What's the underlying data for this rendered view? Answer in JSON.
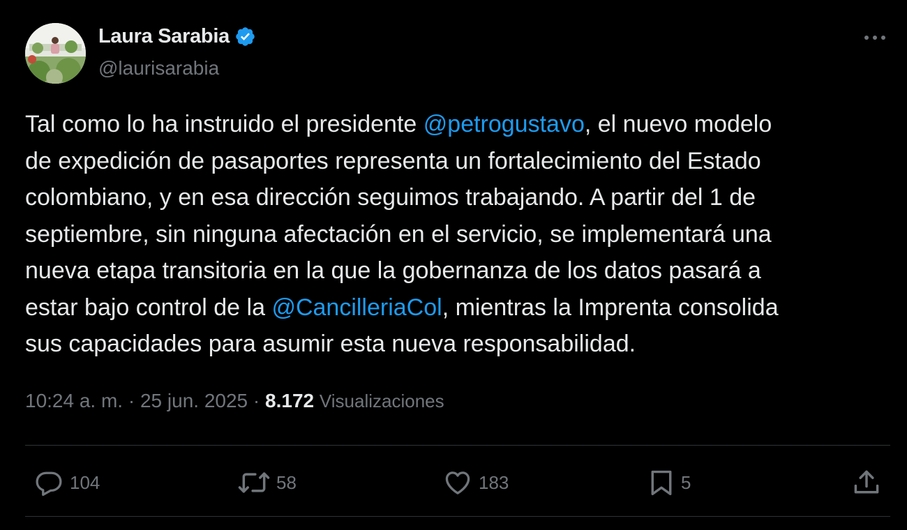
{
  "author": {
    "display_name": "Laura Sarabia",
    "handle": "@laurisarabia",
    "verified_color": "#1d9bf0"
  },
  "tweet": {
    "segments": [
      "Tal como lo ha instruido el presidente ",
      "@petrogustavo",
      ", el nuevo modelo",
      "de expedición de pasaportes representa un fortalecimiento del Estado",
      "colombiano, y en esa dirección seguimos trabajando. A partir del 1 de",
      "septiembre, sin ninguna afectación en el servicio, se implementará una",
      "nueva etapa transitoria en la que la gobernanza de los datos pasará a",
      "estar bajo control de la ",
      "@CancilleriaCol",
      ", mientras la Imprenta consolida",
      "sus capacidades para asumir esta nueva responsabilidad."
    ]
  },
  "meta": {
    "time": "10:24 a. m.",
    "separator": " · ",
    "date": "25 jun. 2025",
    "views_count": "8.172",
    "views_label": "Visualizaciones"
  },
  "actions": {
    "replies": "104",
    "reposts": "58",
    "likes": "183",
    "bookmarks": "5"
  },
  "icons": {
    "more": "more-dots-icon",
    "reply": "reply-icon",
    "repost": "repost-icon",
    "like": "heart-icon",
    "bookmark": "bookmark-icon",
    "share": "share-icon",
    "verified": "verified-badge-icon"
  },
  "colors": {
    "background": "#000000",
    "text": "#e7e9ea",
    "secondary": "#71767b",
    "link": "#1d9bf0",
    "divider": "#2f3336"
  }
}
